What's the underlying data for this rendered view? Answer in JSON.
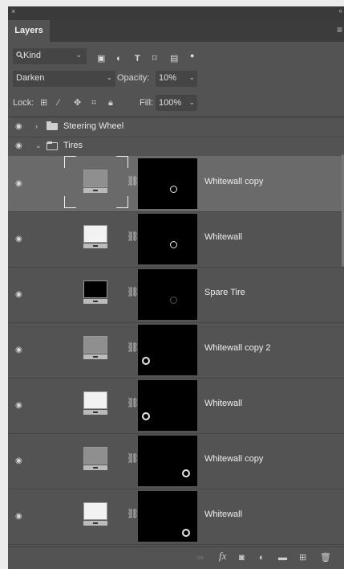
{
  "window": {
    "close_glyph": "×",
    "collapse_glyph": "«"
  },
  "tabs": [
    {
      "label": "Layers"
    }
  ],
  "panel_menu_glyph": "≡",
  "filter": {
    "kind_label": "Kind",
    "kind_icon": "search-icon"
  },
  "filter_icons": [
    "image-icon",
    "adjustment-icon",
    "type-icon",
    "shape-icon",
    "smart-object-icon",
    "filter-toggle-icon"
  ],
  "blend_mode": "Darken",
  "opacity": {
    "label": "Opacity:",
    "value": "10%"
  },
  "lock": {
    "label": "Lock:",
    "icons": [
      "lock-transparent-icon",
      "lock-image-icon",
      "lock-position-icon",
      "lock-artboard-icon",
      "lock-all-icon"
    ]
  },
  "fill": {
    "label": "Fill:",
    "value": "100%"
  },
  "groups": [
    {
      "name": "Steering Wheel",
      "expanded": false
    },
    {
      "name": "Tires",
      "expanded": true
    }
  ],
  "layers": [
    {
      "name": "Whitewall  copy",
      "thumb": "#8f8f8f",
      "selected": true
    },
    {
      "name": "Whitewall",
      "thumb": "#f2f2f2",
      "selected": false
    },
    {
      "name": "Spare Tire",
      "thumb": "#000000",
      "selected": false
    },
    {
      "name": "Whitewall copy 2",
      "thumb": "#8f8f8f",
      "selected": false
    },
    {
      "name": "Whitewall",
      "thumb": "#f2f2f2",
      "selected": false
    },
    {
      "name": "Whitewall copy",
      "thumb": "#8f8f8f",
      "selected": false
    },
    {
      "name": "Whitewall",
      "thumb": "#f2f2f2",
      "selected": false
    }
  ],
  "footer": {
    "fx_label": "fx",
    "icons": [
      "link-layers-icon",
      "fx-icon",
      "add-mask-icon",
      "adjustment-layer-icon",
      "new-group-icon",
      "new-layer-icon",
      "trash-icon"
    ]
  }
}
